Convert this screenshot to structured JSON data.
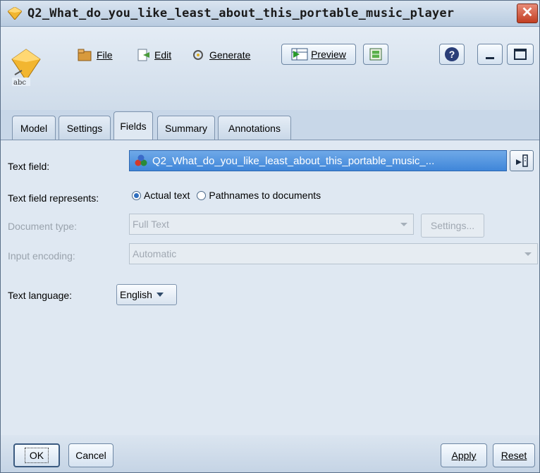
{
  "window": {
    "title": "Q2_What_do_you_like_least_about_this_portable_music_player",
    "close_glyph": "✕"
  },
  "toolbar": {
    "file_label": "File",
    "edit_label": "Edit",
    "generate_label": "Generate",
    "preview_label": "Preview",
    "help_glyph": "?"
  },
  "node": {
    "badge_text": "abc"
  },
  "tabs": [
    {
      "label": "Model",
      "active": false
    },
    {
      "label": "Settings",
      "active": false
    },
    {
      "label": "Fields",
      "active": true
    },
    {
      "label": "Summary",
      "active": false
    },
    {
      "label": "Annotations",
      "active": false
    }
  ],
  "form": {
    "text_field": {
      "label": "Text field:",
      "value": "Q2_What_do_you_like_least_about_this_portable_music_..."
    },
    "represents": {
      "label": "Text field represents:",
      "options": [
        {
          "label": "Actual text",
          "selected": true
        },
        {
          "label": "Pathnames to documents",
          "selected": false
        }
      ]
    },
    "document_type": {
      "label": "Document type:",
      "value": "Full Text",
      "settings_label": "Settings..."
    },
    "input_encoding": {
      "label": "Input encoding:",
      "value": "Automatic"
    },
    "text_language": {
      "label": "Text language:",
      "value": "English"
    }
  },
  "buttons": {
    "ok": "OK",
    "cancel": "Cancel",
    "apply": "Apply",
    "reset": "Reset"
  },
  "colors": {
    "selection_blue": "#3f86d9",
    "close_red": "#c23f22",
    "node_gold": "#f2b630"
  }
}
